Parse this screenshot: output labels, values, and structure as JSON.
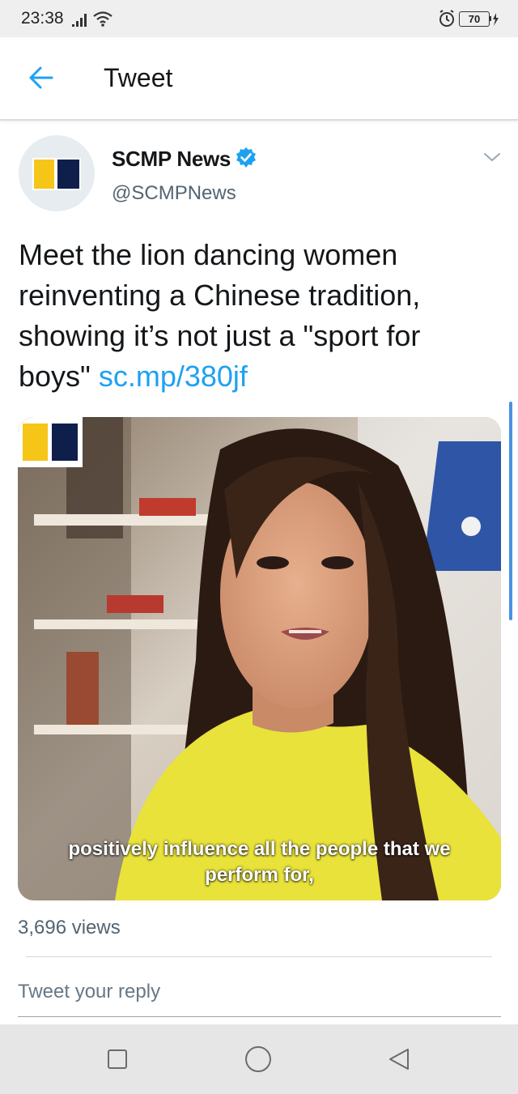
{
  "status_bar": {
    "time": "23:38",
    "battery_level": "70",
    "icons": [
      "signal-icon",
      "wifi-icon",
      "alarm-icon",
      "battery-icon"
    ]
  },
  "header": {
    "title": "Tweet",
    "back_icon": "arrow-left-icon"
  },
  "tweet": {
    "display_name": "SCMP News",
    "username": "@SCMPNews",
    "text": "Meet the lion dancing women reinventing a Chinese tradition, showing it’s not just a \"sport for boys\" ",
    "link_text": "sc.mp/380jf",
    "media": {
      "caption_line1": "positively influence all the people that we",
      "caption_line2": "perform for,"
    },
    "views": "3,696 views"
  },
  "reply": {
    "placeholder": "Tweet your reply"
  },
  "colors": {
    "accent": "#1da1f2",
    "text": "#14171a",
    "secondary_text": "#536471",
    "scmp_yellow": "#f5c518",
    "scmp_navy": "#0f1f4b",
    "shirt_yellow": "#e8e23a"
  },
  "nav_bar": {
    "icons": [
      "recent-apps-icon",
      "home-icon",
      "back-triangle-icon"
    ]
  }
}
